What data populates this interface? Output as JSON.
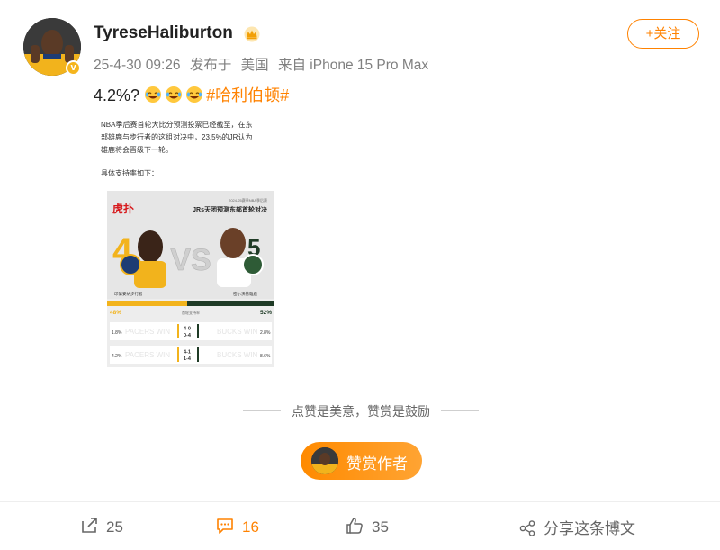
{
  "post": {
    "username": "TyreseHaliburton",
    "time": "25-4-30 09:26",
    "source_prefix": "发布于",
    "location": "美国",
    "device": "来自 iPhone 15 Pro Max",
    "follow_label": "+关注",
    "text": "4.2%?",
    "hashtag": "#哈利伯顿#"
  },
  "image": {
    "lines": [
      "NBA季后赛首轮大比分预测投票已经截至，在东",
      "部雄鹿与步行者的这组对决中，23.5%的JR认为",
      "雄鹿将会晋级下一轮。",
      "具体支持率如下："
    ],
    "poster_brand": "虎扑",
    "poster_subtitle": "2024-25赛季NBA季后赛",
    "poster_title": "JRs天团预测东部首轮对决",
    "seed_left": "4",
    "seed_right": "5",
    "vs": "VS",
    "team_left": "印第安纳步行者",
    "team_right": "密尔沃基雄鹿",
    "pct_left": "48%",
    "pct_mid": "首轮支持率",
    "pct_right": "52%",
    "rows": [
      {
        "left": "1.8%",
        "left_ghost": "PACERS WIN",
        "score1": "4-0",
        "score2": "0-4",
        "right_ghost": "BUCKS WIN",
        "right": "2.8%"
      },
      {
        "left": "4.2%",
        "left_ghost": "PACERS WIN",
        "score1": "4-1",
        "score2": "1-4",
        "right_ghost": "BUCKS WIN",
        "right": "8.6%"
      }
    ]
  },
  "reward": {
    "hint": "点赞是美意，赞赏是鼓励",
    "button_label": "赞赏作者"
  },
  "actions": {
    "share_count": "25",
    "comment_count": "16",
    "like_count": "35",
    "share_label": "分享这条博文"
  },
  "colors": {
    "accent": "#ff8200",
    "pacers_gold": "#f2b31c",
    "bucks_green": "#1f3b26",
    "brand_red": "#d7191c"
  }
}
